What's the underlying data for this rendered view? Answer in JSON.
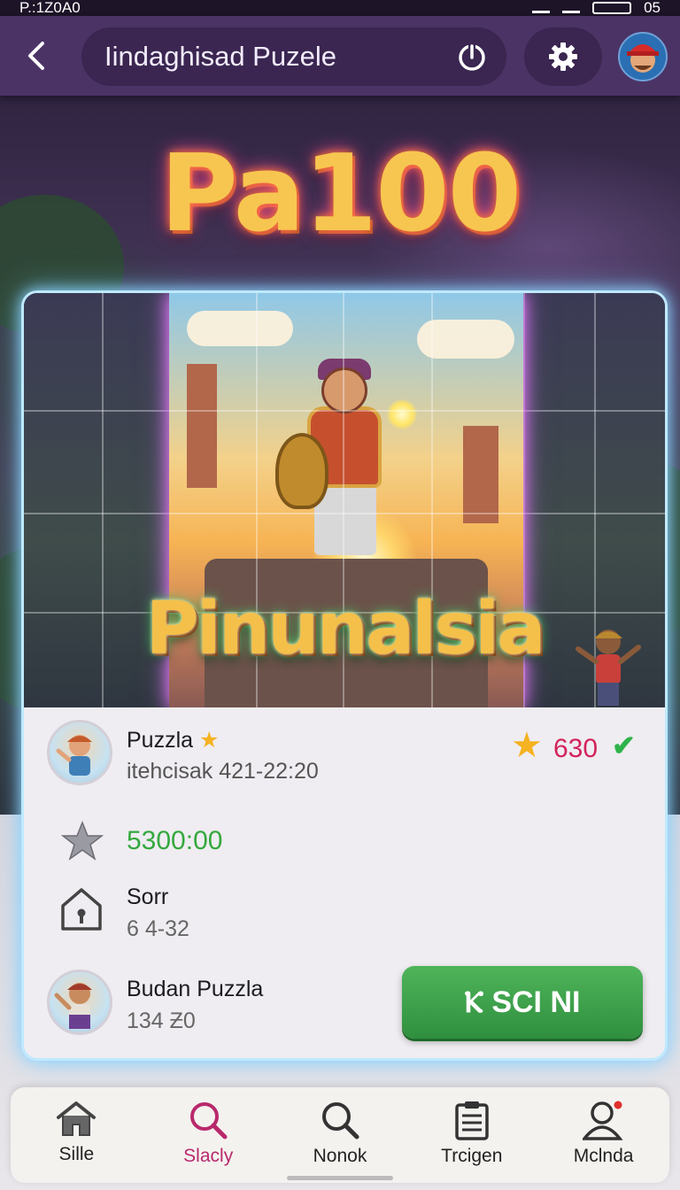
{
  "status_bar": {
    "time": "P.:1Z0A0",
    "battery": "05"
  },
  "app_bar": {
    "title": "Iindaghisad Puzele"
  },
  "hero": {
    "big_title": "Pa100",
    "logo_text": "Pinunalsia"
  },
  "info": {
    "puzzle_name": "Puzzla",
    "puzzle_sub": "itehcisak 421-22:20",
    "score": "630",
    "reward": "5300:00",
    "home_title": "Sorr",
    "home_sub": "6 4-32",
    "friend_title": "Budan Puzzla",
    "friend_sub": "134 Ƶ0",
    "play_button": "Ⲕ SCI NI"
  },
  "nav": {
    "items": [
      {
        "label": "Sille",
        "icon": "home-icon"
      },
      {
        "label": "Slacly",
        "icon": "search-icon",
        "active": true
      },
      {
        "label": "Nonok",
        "icon": "search-icon"
      },
      {
        "label": "Trcigen",
        "icon": "clipboard-icon"
      },
      {
        "label": "Mclnda",
        "icon": "profile-icon"
      }
    ]
  },
  "colors": {
    "app_bar": "#4b3366",
    "accent_pink": "#b8296c",
    "score_red": "#d3235b",
    "reward_green": "#35a83e",
    "play_button": "#3a9f47",
    "card_glow": "#bfe9ff"
  }
}
